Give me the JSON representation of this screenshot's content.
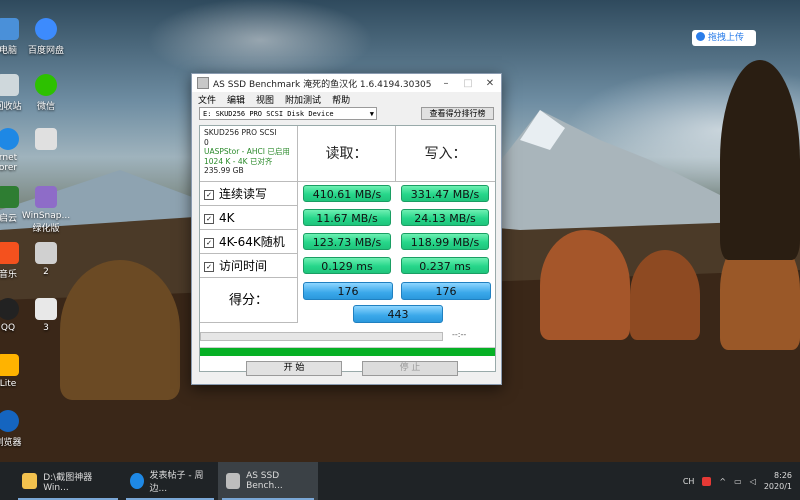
{
  "desktop": {
    "icons": [
      {
        "label": "电脑"
      },
      {
        "label": "百度网盘"
      },
      {
        "label": "回收站"
      },
      {
        "label": "微信"
      },
      {
        "label": "rnet\norer"
      },
      {
        "label": ""
      },
      {
        "label": "启云"
      },
      {
        "label": "WinSnap...\n绿化版"
      },
      {
        "label": "音乐"
      },
      {
        "label": "2"
      },
      {
        "label": "QQ"
      },
      {
        "label": "3"
      },
      {
        "label": "Lite"
      },
      {
        "label": "浏览器"
      }
    ],
    "upload_button": "拖拽上传"
  },
  "window": {
    "title": "AS SSD Benchmark 淹死的鱼汉化 1.6.4194.30305",
    "menu": [
      "文件",
      "编辑",
      "视图",
      "附加测试",
      "帮助"
    ],
    "drive_select": "E: SKUD256 PRO SCSI Disk Device",
    "rank_button": "查看得分排行榜",
    "info": {
      "model": "SKUD256 PRO SCSI",
      "line2": "0",
      "driver": "UASPStor - AHCI 已启用",
      "align": "1024 K - 4K 已对齐",
      "size": "235.99 GB"
    },
    "headers": {
      "read": "读取：",
      "write": "写入："
    },
    "rows": [
      {
        "label": "连续读写",
        "read": "410.61 MB/s",
        "write": "331.47 MB/s"
      },
      {
        "label": "4K",
        "read": "11.67 MB/s",
        "write": "24.13 MB/s"
      },
      {
        "label": "4K-64K随机",
        "read": "123.73 MB/s",
        "write": "118.99 MB/s"
      },
      {
        "label": "访问时间",
        "read": "0.129 ms",
        "write": "0.237 ms"
      }
    ],
    "score": {
      "label": "得分：",
      "read": "176",
      "write": "176",
      "total": "443"
    },
    "elapsed": "--:--",
    "progress_fraction": 1.0,
    "start_button": "开 始",
    "stop_button": "停 止"
  },
  "taskbar": {
    "items": [
      {
        "label": "D:\\截图神器Win..."
      },
      {
        "label": "发表帖子 - 周边..."
      },
      {
        "label": "AS SSD Bench..."
      }
    ],
    "tray": {
      "lang": "CH",
      "time": "8:26",
      "date": "2020/1"
    }
  }
}
